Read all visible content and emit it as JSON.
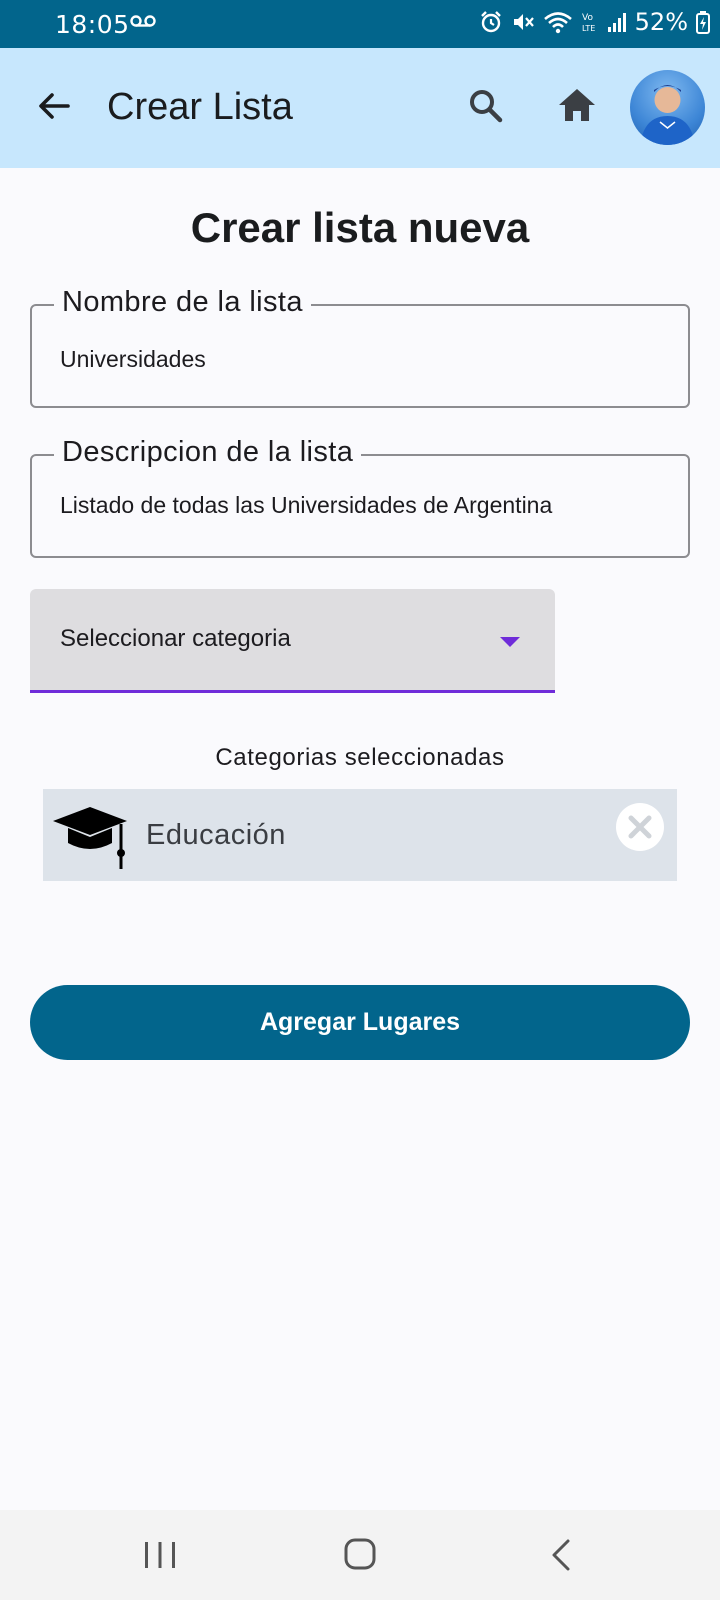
{
  "status_bar": {
    "time": "18:05",
    "battery": "52%"
  },
  "app_bar": {
    "title": "Crear Lista"
  },
  "page": {
    "title": "Crear lista nueva"
  },
  "form": {
    "name_label": "Nombre de la lista",
    "name_value": "Universidades",
    "description_label": "Descripcion de la lista",
    "description_value": "Listado de todas las Universidades de Argentina",
    "category_select_label": "Seleccionar categoria"
  },
  "selected_categories": {
    "heading": "Categorias seleccionadas",
    "items": [
      {
        "label": "Educación",
        "icon": "graduation-cap-icon"
      }
    ]
  },
  "actions": {
    "primary_label": "Agregar Lugares"
  },
  "colors": {
    "primary": "#02658c",
    "app_bar_bg": "#c7e7fd",
    "accent": "#6f2bd9",
    "chip_bg": "#dde3ea"
  }
}
